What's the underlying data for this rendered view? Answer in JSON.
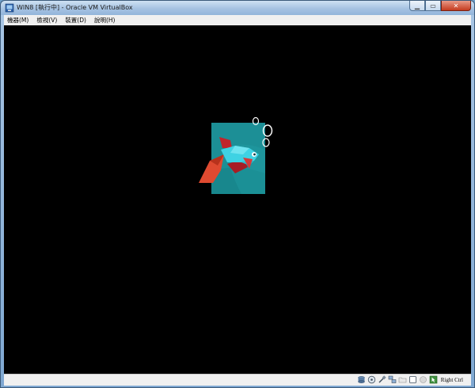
{
  "window": {
    "title": "WIN8 [執行中] - Oracle VM VirtualBox"
  },
  "menu": {
    "items": [
      "機器(M)",
      "檢視(V)",
      "裝置(D)",
      "說明(H)"
    ]
  },
  "guest_screen": {
    "background": "#000000",
    "boot_logo": "betta-fish-logo"
  },
  "status_bar": {
    "icons": [
      "hard-disk-icon",
      "optical-drive-icon",
      "usb-icon",
      "network-icon",
      "shared-folders-icon",
      "display-icon",
      "video-capture-icon",
      "mouse-integration-icon",
      "host-key-icon"
    ],
    "host_key_label": "Right Ctrl"
  },
  "colors": {
    "logo_tile": "#1c8f96",
    "fish_body": "#3fd2e3",
    "fish_fin": "#c0242c",
    "fish_tail": "#df4a30"
  }
}
